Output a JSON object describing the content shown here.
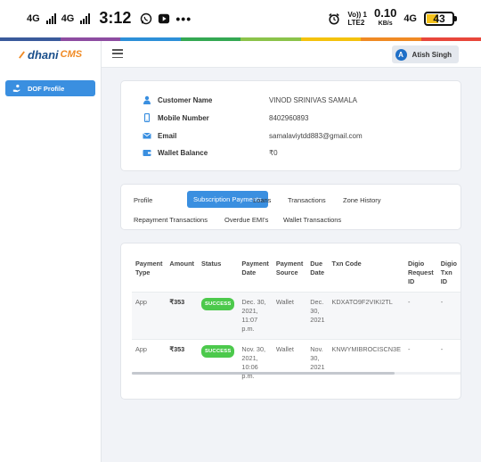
{
  "status_bar": {
    "net1": "4G",
    "net2": "4G",
    "time": "3:12",
    "volte_top": "Vo)) 1",
    "volte_bottom": "LTE2",
    "speed_value": "0.10",
    "speed_unit": "KB/s",
    "net3": "4G",
    "battery_level": "43",
    "icons": [
      "signal-icon",
      "whatsapp-icon",
      "youtube-icon",
      "more-dots-icon",
      "alarm-icon",
      "battery-icon"
    ]
  },
  "color_strip": [
    "#3a5a9b",
    "#8d4ca1",
    "#2d8fd8",
    "#34a853",
    "#8bc34a",
    "#f4c20d",
    "#f08a24",
    "#e8473b"
  ],
  "brand": {
    "name": "dhani",
    "suffix": "CMS"
  },
  "header": {
    "user_initial": "A",
    "user_name": "Atish Singh"
  },
  "sidebar": {
    "items": [
      {
        "label": "DOF Profile",
        "icon": "hand-coin-icon",
        "active": true
      }
    ]
  },
  "customer": {
    "rows": [
      {
        "label": "Customer Name",
        "value": "VINOD SRINIVAS SAMALA",
        "icon": "user-icon"
      },
      {
        "label": "Mobile Number",
        "value": "8402960893",
        "icon": "mobile-icon"
      },
      {
        "label": "Email",
        "value": "samalaviytdd883@gmail.com",
        "icon": "envelope-icon"
      },
      {
        "label": "Wallet Balance",
        "value": "₹0",
        "icon": "wallet-icon"
      }
    ]
  },
  "tabs": [
    {
      "label": "Profile",
      "active": false
    },
    {
      "label": "Subscription Payments",
      "active": true
    },
    {
      "label": "Loans",
      "active": false
    },
    {
      "label": "Transactions",
      "active": false
    },
    {
      "label": "Zone History",
      "active": false
    },
    {
      "label": "Repayment Transactions",
      "active": false
    },
    {
      "label": "Overdue EMI's",
      "active": false
    },
    {
      "label": "Wallet Transactions",
      "active": false
    }
  ],
  "table": {
    "headers": [
      "Payment Type",
      "Amount",
      "Status",
      "Payment Date",
      "Payment Source",
      "Due Date",
      "Txn Code",
      "Digio Request ID",
      "Digio Txn ID"
    ],
    "rows": [
      {
        "payment_type": "App",
        "amount": "₹353",
        "status": "SUCCESS",
        "payment_date": "Dec. 30, 2021, 11:07 p.m.",
        "payment_source": "Wallet",
        "due_date": "Dec. 30, 2021",
        "txn_code": "KDXATO9F2VIKI2TL",
        "digio_request_id": "-",
        "digio_txn_id": "-"
      },
      {
        "payment_type": "App",
        "amount": "₹353",
        "status": "SUCCESS",
        "payment_date": "Nov. 30, 2021, 10:06 p.m.",
        "payment_source": "Wallet",
        "due_date": "Nov. 30, 2021",
        "txn_code": "KNWYMIBROCISCN3E",
        "digio_request_id": "-",
        "digio_txn_id": "-"
      }
    ]
  }
}
